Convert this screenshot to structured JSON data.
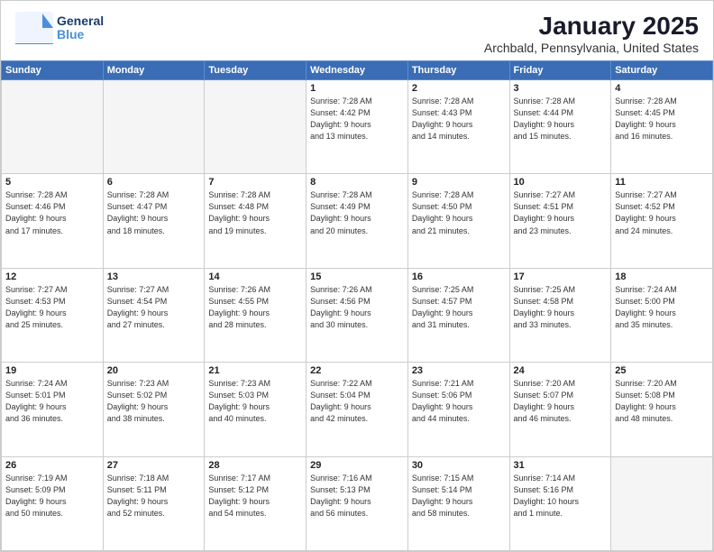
{
  "header": {
    "logo_general": "General",
    "logo_blue": "Blue",
    "month": "January 2025",
    "location": "Archbald, Pennsylvania, United States"
  },
  "weekdays": [
    "Sunday",
    "Monday",
    "Tuesday",
    "Wednesday",
    "Thursday",
    "Friday",
    "Saturday"
  ],
  "weeks": [
    [
      {
        "day": "",
        "info": ""
      },
      {
        "day": "",
        "info": ""
      },
      {
        "day": "",
        "info": ""
      },
      {
        "day": "1",
        "info": "Sunrise: 7:28 AM\nSunset: 4:42 PM\nDaylight: 9 hours\nand 13 minutes."
      },
      {
        "day": "2",
        "info": "Sunrise: 7:28 AM\nSunset: 4:43 PM\nDaylight: 9 hours\nand 14 minutes."
      },
      {
        "day": "3",
        "info": "Sunrise: 7:28 AM\nSunset: 4:44 PM\nDaylight: 9 hours\nand 15 minutes."
      },
      {
        "day": "4",
        "info": "Sunrise: 7:28 AM\nSunset: 4:45 PM\nDaylight: 9 hours\nand 16 minutes."
      }
    ],
    [
      {
        "day": "5",
        "info": "Sunrise: 7:28 AM\nSunset: 4:46 PM\nDaylight: 9 hours\nand 17 minutes."
      },
      {
        "day": "6",
        "info": "Sunrise: 7:28 AM\nSunset: 4:47 PM\nDaylight: 9 hours\nand 18 minutes."
      },
      {
        "day": "7",
        "info": "Sunrise: 7:28 AM\nSunset: 4:48 PM\nDaylight: 9 hours\nand 19 minutes."
      },
      {
        "day": "8",
        "info": "Sunrise: 7:28 AM\nSunset: 4:49 PM\nDaylight: 9 hours\nand 20 minutes."
      },
      {
        "day": "9",
        "info": "Sunrise: 7:28 AM\nSunset: 4:50 PM\nDaylight: 9 hours\nand 21 minutes."
      },
      {
        "day": "10",
        "info": "Sunrise: 7:27 AM\nSunset: 4:51 PM\nDaylight: 9 hours\nand 23 minutes."
      },
      {
        "day": "11",
        "info": "Sunrise: 7:27 AM\nSunset: 4:52 PM\nDaylight: 9 hours\nand 24 minutes."
      }
    ],
    [
      {
        "day": "12",
        "info": "Sunrise: 7:27 AM\nSunset: 4:53 PM\nDaylight: 9 hours\nand 25 minutes."
      },
      {
        "day": "13",
        "info": "Sunrise: 7:27 AM\nSunset: 4:54 PM\nDaylight: 9 hours\nand 27 minutes."
      },
      {
        "day": "14",
        "info": "Sunrise: 7:26 AM\nSunset: 4:55 PM\nDaylight: 9 hours\nand 28 minutes."
      },
      {
        "day": "15",
        "info": "Sunrise: 7:26 AM\nSunset: 4:56 PM\nDaylight: 9 hours\nand 30 minutes."
      },
      {
        "day": "16",
        "info": "Sunrise: 7:25 AM\nSunset: 4:57 PM\nDaylight: 9 hours\nand 31 minutes."
      },
      {
        "day": "17",
        "info": "Sunrise: 7:25 AM\nSunset: 4:58 PM\nDaylight: 9 hours\nand 33 minutes."
      },
      {
        "day": "18",
        "info": "Sunrise: 7:24 AM\nSunset: 5:00 PM\nDaylight: 9 hours\nand 35 minutes."
      }
    ],
    [
      {
        "day": "19",
        "info": "Sunrise: 7:24 AM\nSunset: 5:01 PM\nDaylight: 9 hours\nand 36 minutes."
      },
      {
        "day": "20",
        "info": "Sunrise: 7:23 AM\nSunset: 5:02 PM\nDaylight: 9 hours\nand 38 minutes."
      },
      {
        "day": "21",
        "info": "Sunrise: 7:23 AM\nSunset: 5:03 PM\nDaylight: 9 hours\nand 40 minutes."
      },
      {
        "day": "22",
        "info": "Sunrise: 7:22 AM\nSunset: 5:04 PM\nDaylight: 9 hours\nand 42 minutes."
      },
      {
        "day": "23",
        "info": "Sunrise: 7:21 AM\nSunset: 5:06 PM\nDaylight: 9 hours\nand 44 minutes."
      },
      {
        "day": "24",
        "info": "Sunrise: 7:20 AM\nSunset: 5:07 PM\nDaylight: 9 hours\nand 46 minutes."
      },
      {
        "day": "25",
        "info": "Sunrise: 7:20 AM\nSunset: 5:08 PM\nDaylight: 9 hours\nand 48 minutes."
      }
    ],
    [
      {
        "day": "26",
        "info": "Sunrise: 7:19 AM\nSunset: 5:09 PM\nDaylight: 9 hours\nand 50 minutes."
      },
      {
        "day": "27",
        "info": "Sunrise: 7:18 AM\nSunset: 5:11 PM\nDaylight: 9 hours\nand 52 minutes."
      },
      {
        "day": "28",
        "info": "Sunrise: 7:17 AM\nSunset: 5:12 PM\nDaylight: 9 hours\nand 54 minutes."
      },
      {
        "day": "29",
        "info": "Sunrise: 7:16 AM\nSunset: 5:13 PM\nDaylight: 9 hours\nand 56 minutes."
      },
      {
        "day": "30",
        "info": "Sunrise: 7:15 AM\nSunset: 5:14 PM\nDaylight: 9 hours\nand 58 minutes."
      },
      {
        "day": "31",
        "info": "Sunrise: 7:14 AM\nSunset: 5:16 PM\nDaylight: 10 hours\nand 1 minute."
      },
      {
        "day": "",
        "info": ""
      }
    ]
  ]
}
